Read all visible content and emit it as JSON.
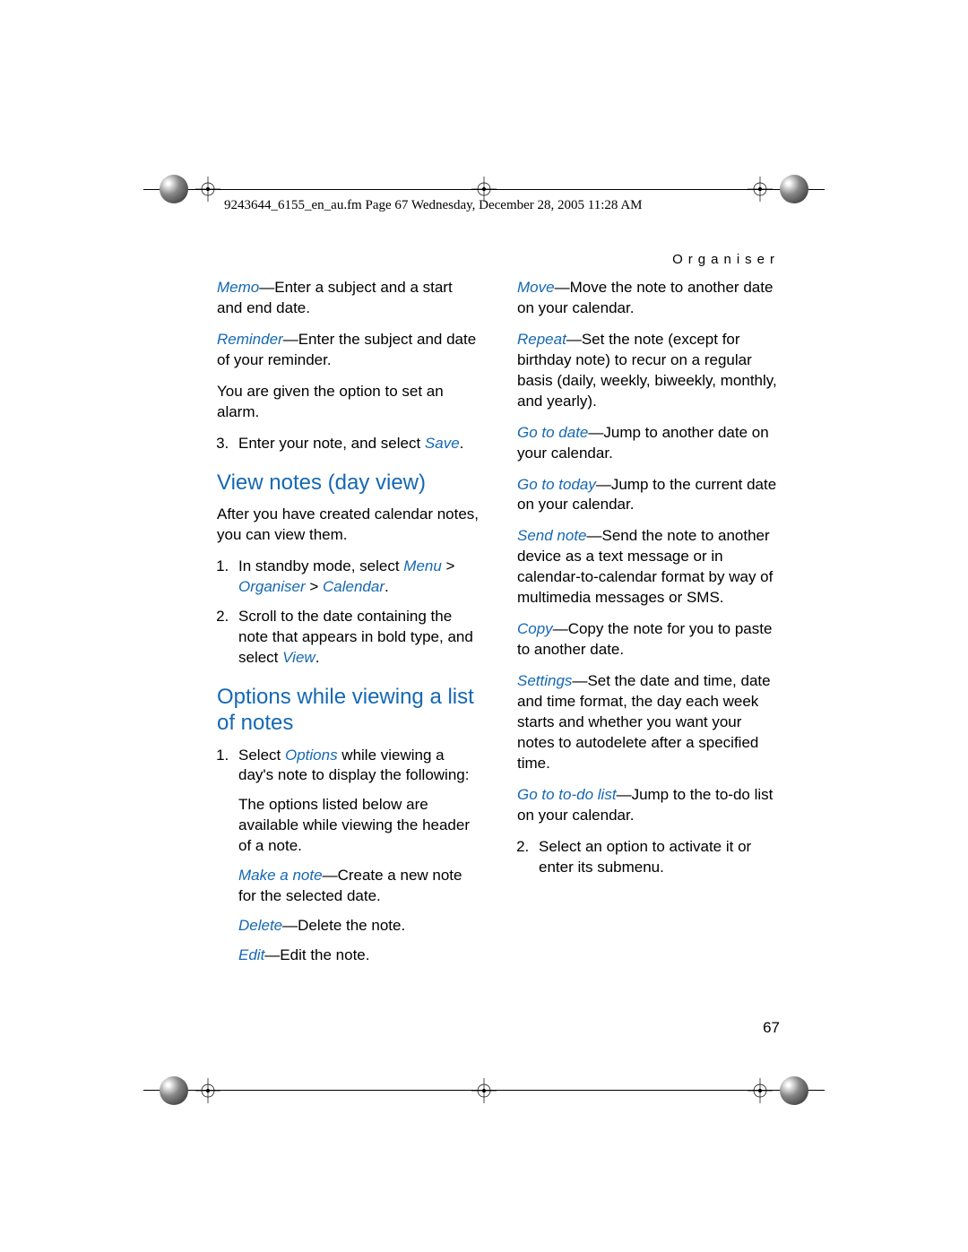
{
  "header_meta": "9243644_6155_en_au.fm  Page 67  Wednesday, December 28, 2005  11:28 AM",
  "section_name": "Organiser",
  "page_number": "67",
  "col1": {
    "memo_label": "Memo",
    "memo_text": "—Enter a subject and a start and end date.",
    "reminder_label": "Reminder",
    "reminder_text": "—Enter the subject and date of your reminder.",
    "alarm_text": "You are given the option to set an alarm.",
    "step3_pre": "Enter your note, and select ",
    "step3_link": "Save",
    "step3_post": ".",
    "h_view": "View notes (day view)",
    "view_intro": "After you have created calendar notes, you can view them.",
    "view_s1_pre": "In standby mode, select ",
    "view_s1_l1": "Menu",
    "view_s1_gt1": " > ",
    "view_s1_l2": "Organiser",
    "view_s1_gt2": " > ",
    "view_s1_l3": "Calendar",
    "view_s1_post": ".",
    "view_s2_pre": "Scroll to the date containing the note that appears in bold type, and select ",
    "view_s2_link": "View",
    "view_s2_post": ".",
    "h_options": "Options while viewing a list of notes",
    "opt_s1_pre": "Select ",
    "opt_s1_link": "Options",
    "opt_s1_post": " while viewing a day's note to display the following:",
    "opt_s1_p2": "The options listed below are available while viewing the header of a note.",
    "make_label": "Make a note",
    "make_text": "—Create a new note for the selected date.",
    "delete_label": "Delete",
    "delete_text": "—Delete the note.",
    "edit_label": "Edit",
    "edit_text": "—Edit the note."
  },
  "col2": {
    "move_label": "Move",
    "move_text": "—Move the note to another date on your calendar.",
    "repeat_label": "Repeat",
    "repeat_text": "—Set the note (except for birthday note) to recur on a regular basis (daily, weekly, biweekly, monthly, and yearly).",
    "gotodate_label": "Go to date",
    "gotodate_text": "—Jump to another date on your calendar.",
    "gototoday_label": "Go to today",
    "gototoday_text": "—Jump to the current date on your calendar.",
    "sendnote_label": "Send note",
    "sendnote_text": "—Send the note to another device as a text message or in calendar-to-calendar format by way of multimedia messages or SMS.",
    "copy_label": "Copy",
    "copy_text": "—Copy the note for you to paste to another date.",
    "settings_label": "Settings",
    "settings_text": "—Set the date and time, date and time format, the day each week starts and whether you want your notes to autodelete after a specified time.",
    "todolist_label": "Go to to-do list",
    "todolist_text": "—Jump to the to-do list on your calendar.",
    "step2": "Select an option to activate it or enter its submenu."
  }
}
